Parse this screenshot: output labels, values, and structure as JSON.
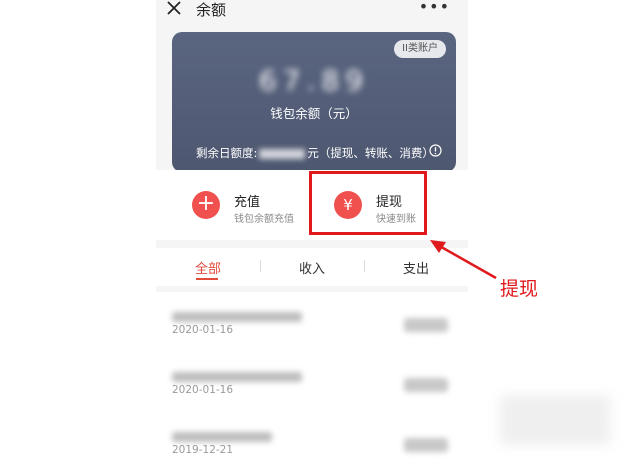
{
  "header": {
    "title": "余额",
    "close_icon": "close-icon",
    "more_label": "•••"
  },
  "card": {
    "tag": "II类账户",
    "amount": "67.89",
    "amount_label": "钱包余额（元）",
    "limit_prefix": "剩余日额度:",
    "limit_suffix": "元（提现、转账、消费）",
    "info_icon": "info-icon",
    "color": "#545e78"
  },
  "actions": [
    {
      "icon": "plus-icon",
      "glyph": "+",
      "title": "充值",
      "subtitle": "钱包余额充值"
    },
    {
      "icon": "yen-icon",
      "glyph": "¥",
      "title": "提现",
      "subtitle": "快速到账"
    }
  ],
  "tabs": [
    {
      "label": "全部",
      "active": true
    },
    {
      "label": "收入",
      "active": false
    },
    {
      "label": "支出",
      "active": false
    }
  ],
  "transactions": [
    {
      "date": "2020-01-16"
    },
    {
      "date": "2020-01-16"
    },
    {
      "date": "2019-12-21"
    }
  ],
  "annotation": {
    "label": "提现",
    "color": "#e0191c"
  },
  "colors": {
    "accent": "#f0514f",
    "tab_active": "#e24a3a"
  }
}
